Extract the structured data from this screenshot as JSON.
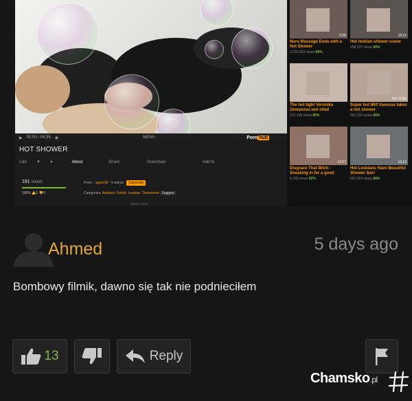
{
  "video": {
    "title": "HOT SHOWER",
    "time": "00:00 / 04:35",
    "menu_label": "MENU",
    "logo_text_1": "Porn",
    "logo_text_2": "hub",
    "tabs": [
      "Like",
      "About",
      "Share",
      "Download",
      "Add to"
    ],
    "views_count": "191",
    "views_label": "VIEWS",
    "rating": "100%",
    "likes": "1",
    "dislikes": "0",
    "from_label": "From:",
    "uploader": "agner99",
    "video_count": "4 videos",
    "subscribe_label": "Subscribe",
    "categories_label": "Categories:",
    "categories": "Amateur, Fetish, Lesbian, Threesome",
    "suggest_label": "Suggest",
    "show_more": "Show more"
  },
  "related": [
    {
      "title": "Nuru Massage Ends with a Hot Shower",
      "views": "2,291,993 views",
      "pct": "84%",
      "duration": "5:08"
    },
    {
      "title": "Hot lesbian shower scene",
      "views": "258,107 views",
      "pct": "90%",
      "duration": "18:15"
    },
    {
      "title": "The hot tight Veronika Zemanova wet oiled",
      "views": "572,148 views",
      "pct": "85%",
      "duration": ""
    },
    {
      "title": "Super hot Milf Vanessa takes a hot shower",
      "views": "461,234 views",
      "pct": "88%",
      "duration": "HD 12:50"
    },
    {
      "title": "Disgrace That Bitch - Sneaking in for a good",
      "views": "6,768 views",
      "pct": "92%",
      "duration": "14:27"
    },
    {
      "title": "Hot Lesbians Have Beautiful Shower Sex!",
      "views": "601,414 views",
      "pct": "84%",
      "duration": "13:12"
    }
  ],
  "comment": {
    "username": "Ahmed",
    "time_ago": "5 days ago",
    "text": "Bombowy filmik, dawno się tak nie podnieciłem",
    "like_count": "13",
    "reply_label": "Reply"
  },
  "watermark": {
    "brand": "Chamsko",
    "tld": ".pl"
  },
  "colors": {
    "accent": "#e3a53b",
    "like_green": "#82b54a",
    "background": "#161616"
  },
  "icons": [
    "avatar-icon",
    "thumbs-up-icon",
    "thumbs-down-icon",
    "reply-arrow-icon",
    "flag-icon",
    "hash-icon"
  ]
}
